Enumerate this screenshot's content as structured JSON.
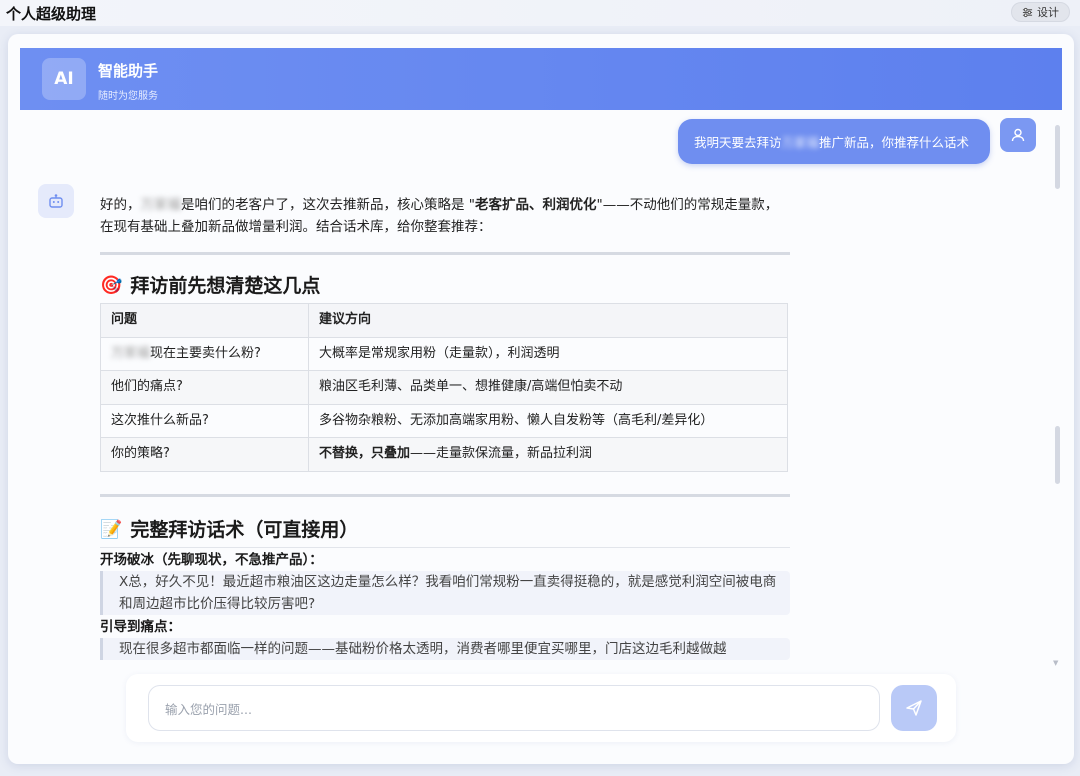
{
  "app": {
    "title": "个人超级助理",
    "design_label": "设计"
  },
  "header": {
    "badge": "AI",
    "name": "智能助手",
    "subtitle": "随时为您服务"
  },
  "user_message": {
    "prefix": "我明天要去拜访",
    "masked": "万家福",
    "suffix": "推广新品，你推荐什么话术"
  },
  "reply": {
    "intro_a": "好的，",
    "intro_masked": "万家福",
    "intro_b": "是咱们的老客户了，这次去推新品，核心策略是 \"",
    "intro_bold": "老客扩品、利润优化",
    "intro_c": "\"——不动他们的常规走量款，在现有基础上叠加新品做增量利润。结合话术库，给你整套推荐：",
    "section1": {
      "emoji": "🎯",
      "title": "拜访前先想清楚这几点"
    },
    "table": {
      "headers": [
        "问题",
        "建议方向"
      ],
      "rows": [
        {
          "masked": "万家福",
          "q": "现在主要卖什么粉?",
          "a": "大概率是常规家用粉（走量款），利润透明"
        },
        {
          "masked": "",
          "q": "他们的痛点?",
          "a": "粮油区毛利薄、品类单一、想推健康/高端但怕卖不动"
        },
        {
          "masked": "",
          "q": "这次推什么新品?",
          "a": "多谷物杂粮粉、无添加高端家用粉、懒人自发粉等（高毛利/差异化）"
        },
        {
          "masked": "",
          "q": "你的策略?",
          "a_bold": "不替换，只叠加",
          "a": "——走量款保流量，新品拉利润"
        }
      ]
    },
    "section2": {
      "emoji": "📝",
      "title": "完整拜访话术（可直接用）"
    },
    "opening_label": "开场破冰（先聊现状，不急推产品）：",
    "opening_quote": "X总，好久不见！最近超市粮油区这边走量怎么样？我看咱们常规粉一直卖得挺稳的，就是感觉利润空间被电商和周边超市比价压得比较厉害吧?",
    "pain_label": "引导到痛点：",
    "pain_quote": "现在很多超市都面临一样的问题——基础粉价格太透明，消费者哪里便宜买哪里，门店这边毛利越做越"
  },
  "input": {
    "placeholder": "输入您的问题..."
  },
  "colors": {
    "accent": "#6f8ef0",
    "header": "#5d80ee"
  }
}
